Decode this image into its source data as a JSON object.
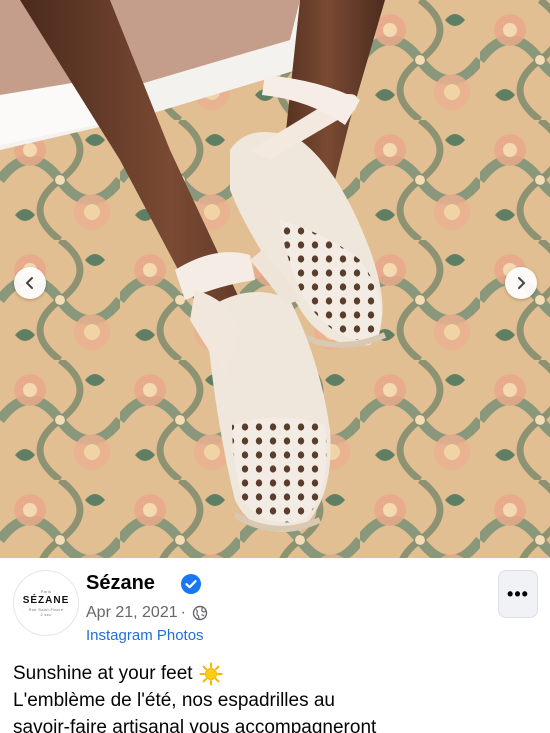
{
  "post": {
    "author": "Sézane",
    "date": "Apr 21, 2021",
    "separator": "·",
    "source": "Instagram Photos",
    "avatar": {
      "top_text": "Paris",
      "brand": "SÉZANE",
      "bottom_text_1": "Rue Saint-Fiacre",
      "bottom_text_2": "2 sec"
    },
    "more_label": "•••",
    "caption_lines": [
      "Sunshine at your feet",
      "L'emblème de l'été, nos espadrilles au",
      "savoir-faire artisanal vous accompagneront"
    ]
  },
  "icons": {
    "verified": "verified-badge-icon",
    "globe": "globe-icon",
    "sun": "sun-emoji-icon",
    "prev": "chevron-left-icon",
    "next": "chevron-right-icon"
  },
  "colors": {
    "verified_blue": "#1877f2",
    "link_blue": "#216fdb",
    "meta_gray": "#65676b",
    "text": "#050505"
  }
}
